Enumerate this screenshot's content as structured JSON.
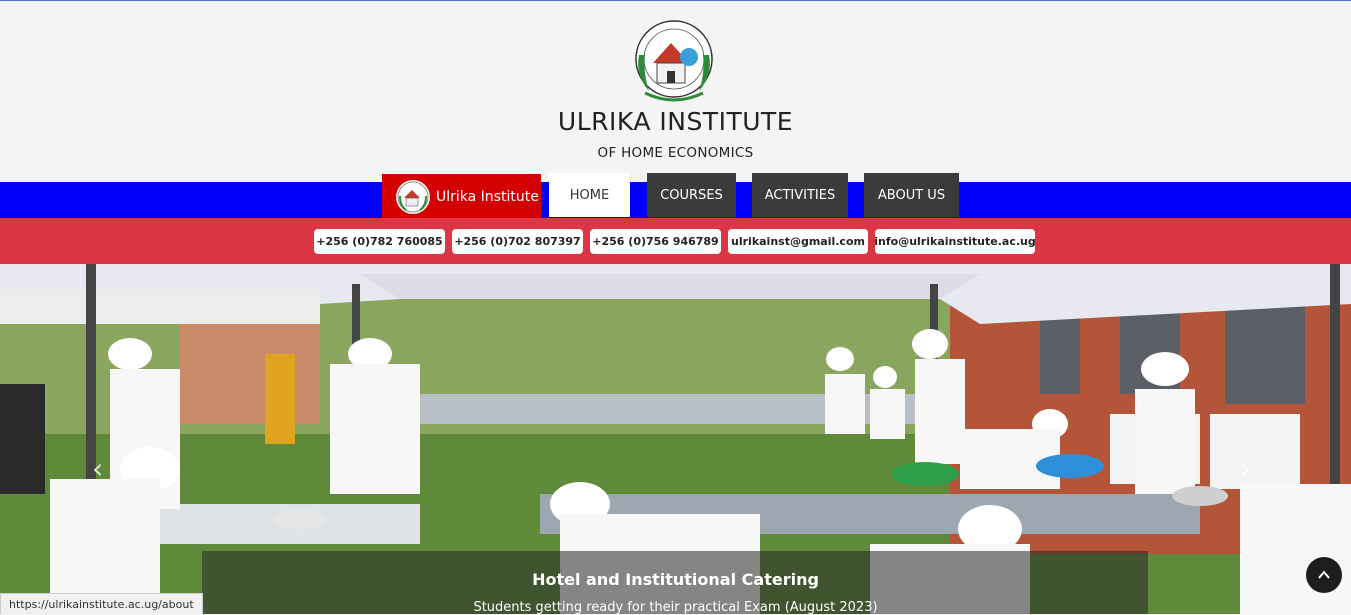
{
  "header": {
    "title": "ULRIKA INSTITUTE",
    "subtitle": "OF HOME ECONOMICS",
    "logo_icon": "institute-crest-icon"
  },
  "nav": {
    "brand_label": "Ulrika Institute",
    "items": [
      {
        "label": "HOME",
        "active": true
      },
      {
        "label": "COURSES"
      },
      {
        "label": "ACTIVITIES"
      },
      {
        "label": "ABOUT US"
      }
    ]
  },
  "contacts": [
    "+256 (0)782 760085",
    "+256 (0)702 807397",
    "+256 (0)756 946789",
    "ulrikainst@gmail.com",
    "info@ulrikainstitute.ac.ug"
  ],
  "hero": {
    "caption_title": "Hotel and Institutional Catering",
    "caption_text": "Students getting ready for their practical Exam (August 2023)",
    "prev_icon": "chevron-left-icon",
    "next_icon": "chevron-right-icon"
  },
  "scroll_top_icon": "chevron-up-icon",
  "status_url": "https://ulrikainstitute.ac.ug/about",
  "colors": {
    "navbar": "#0000ff",
    "brand": "#d40000",
    "contactbar": "#dc3545",
    "nav_button": "#3b3b3b"
  }
}
